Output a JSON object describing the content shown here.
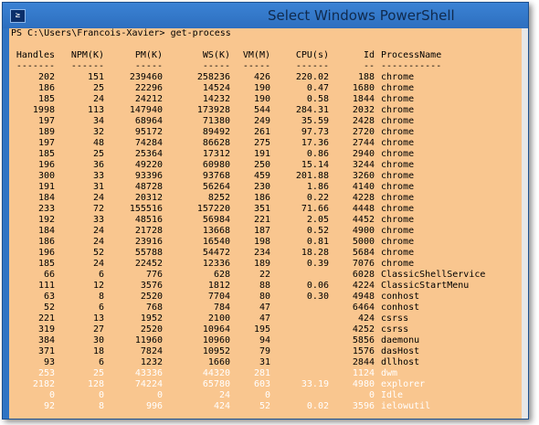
{
  "window": {
    "title": "Select Windows PowerShell",
    "icon": "powershell-icon",
    "icon_glyph": "≥"
  },
  "console": {
    "prompt": "PS C:\\Users\\Francois-Xavier> get-process",
    "columns": [
      "Handles",
      "NPM(K)",
      "PM(K)",
      "WS(K)",
      "VM(M)",
      "CPU(s)",
      "Id",
      "ProcessName"
    ],
    "separators": [
      "-------",
      "------",
      "-----",
      "-----",
      "-----",
      "------",
      "--",
      "-----------"
    ],
    "rows": [
      [
        "202",
        "151",
        "239460",
        "258236",
        "426",
        "220.02",
        "188",
        "chrome"
      ],
      [
        "186",
        "25",
        "22296",
        "14524",
        "190",
        "0.47",
        "1680",
        "chrome"
      ],
      [
        "185",
        "24",
        "24212",
        "14232",
        "190",
        "0.58",
        "1844",
        "chrome"
      ],
      [
        "1998",
        "113",
        "147940",
        "173928",
        "544",
        "284.31",
        "2032",
        "chrome"
      ],
      [
        "197",
        "34",
        "68964",
        "71380",
        "249",
        "35.59",
        "2428",
        "chrome"
      ],
      [
        "189",
        "32",
        "95172",
        "89492",
        "261",
        "97.73",
        "2720",
        "chrome"
      ],
      [
        "197",
        "48",
        "74284",
        "86628",
        "275",
        "17.36",
        "2744",
        "chrome"
      ],
      [
        "185",
        "25",
        "25364",
        "17312",
        "191",
        "0.86",
        "2940",
        "chrome"
      ],
      [
        "196",
        "36",
        "49220",
        "60980",
        "250",
        "15.14",
        "3244",
        "chrome"
      ],
      [
        "300",
        "33",
        "93396",
        "93768",
        "459",
        "201.88",
        "3260",
        "chrome"
      ],
      [
        "191",
        "31",
        "48728",
        "56264",
        "230",
        "1.86",
        "4140",
        "chrome"
      ],
      [
        "184",
        "24",
        "20312",
        "8252",
        "186",
        "0.22",
        "4228",
        "chrome"
      ],
      [
        "233",
        "72",
        "155516",
        "157220",
        "351",
        "71.66",
        "4448",
        "chrome"
      ],
      [
        "192",
        "33",
        "48516",
        "56984",
        "221",
        "2.05",
        "4452",
        "chrome"
      ],
      [
        "184",
        "24",
        "21728",
        "13668",
        "187",
        "0.52",
        "4900",
        "chrome"
      ],
      [
        "186",
        "24",
        "23916",
        "16540",
        "198",
        "0.81",
        "5000",
        "chrome"
      ],
      [
        "196",
        "52",
        "55788",
        "54472",
        "234",
        "18.28",
        "5684",
        "chrome"
      ],
      [
        "185",
        "24",
        "22452",
        "12336",
        "189",
        "0.39",
        "7076",
        "chrome"
      ],
      [
        "66",
        "6",
        "776",
        "628",
        "22",
        "",
        "6028",
        "ClassicShellService"
      ],
      [
        "111",
        "12",
        "3576",
        "1812",
        "88",
        "0.06",
        "4224",
        "ClassicStartMenu"
      ],
      [
        "63",
        "8",
        "2520",
        "7704",
        "80",
        "0.30",
        "4948",
        "conhost"
      ],
      [
        "52",
        "6",
        "768",
        "784",
        "47",
        "",
        "6464",
        "conhost"
      ],
      [
        "221",
        "13",
        "1952",
        "2100",
        "47",
        "",
        "424",
        "csrss"
      ],
      [
        "319",
        "27",
        "2520",
        "10964",
        "195",
        "",
        "4252",
        "csrss"
      ],
      [
        "384",
        "30",
        "11960",
        "10960",
        "94",
        "",
        "5856",
        "daemonu"
      ],
      [
        "371",
        "18",
        "7824",
        "10952",
        "79",
        "",
        "1576",
        "dasHost"
      ],
      [
        "93",
        "6",
        "1232",
        "1660",
        "31",
        "",
        "2844",
        "dllhost"
      ],
      [
        "253",
        "25",
        "43336",
        "44320",
        "281",
        "",
        "1124",
        "dwm"
      ],
      [
        "2182",
        "128",
        "74224",
        "65780",
        "603",
        "33.19",
        "4980",
        "explorer"
      ],
      [
        "0",
        "0",
        "0",
        "24",
        "0",
        "",
        "0",
        "Idle"
      ],
      [
        "92",
        "8",
        "996",
        "424",
        "52",
        "0.02",
        "3596",
        "ielowutil"
      ]
    ],
    "selected_rows_from_index": 27,
    "colors": {
      "console_background": "#f9c68f",
      "selection_background": "#0d2769",
      "selection_text": "#ffffff",
      "window_frame": "#2f74c4"
    }
  }
}
